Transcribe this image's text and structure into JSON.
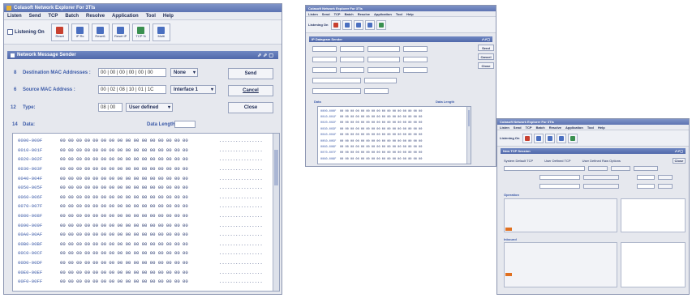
{
  "win1": {
    "title": "Colasoft Network Explorer For 3Tls",
    "menu": [
      "Listen",
      "Send",
      "TCP",
      "Batch",
      "Resolve",
      "Application",
      "Tool",
      "Help"
    ],
    "listen_toggle": "Listening On",
    "tools": [
      "Reset",
      "IP Rc",
      "Reset1",
      "Reset IP",
      "TCP %",
      "Multi"
    ],
    "panel_title": "Network Message Sender",
    "dest_label": "Destination MAC Addresses :",
    "dest_value": "00 | 00 | 00 | 00 | 00 | 00",
    "dest_select": "None",
    "src_label": "Source MAC Address :",
    "src_value": "00 | 02 | 08 | 10 | 01 | 1C",
    "src_select": "Interface 1",
    "type_label": "Type:",
    "type_value": "08 | 00",
    "type_select": "User defined",
    "data_label": "Data:",
    "data_length_label": "Data Length:",
    "send_btn": "Send",
    "cancel_btn": "Cancel",
    "close_btn": "Close",
    "num_dest": "8",
    "num_src": "6",
    "num_type": "12",
    "num_data": "14",
    "hex_rows": [
      {
        "addr": "0000-000F",
        "bytes": "00 00 00 00 00 00 00 00 00 00 00 00 00 00 00 00",
        "ascii": "................"
      },
      {
        "addr": "0010-001F",
        "bytes": "00 00 00 00 00 00 00 00 00 00 00 00 00 00 00 00",
        "ascii": "................"
      },
      {
        "addr": "0020-002F",
        "bytes": "00 00 00 00 00 00 00 00 00 00 00 00 00 00 00 00",
        "ascii": "................"
      },
      {
        "addr": "0030-003F",
        "bytes": "00 00 00 00 00 00 00 00 00 00 00 00 00 00 00 00",
        "ascii": "................"
      },
      {
        "addr": "0040-004F",
        "bytes": "00 00 00 00 00 00 00 00 00 00 00 00 00 00 00 00",
        "ascii": "................"
      },
      {
        "addr": "0050-005F",
        "bytes": "00 00 00 00 00 00 00 00 00 00 00 00 00 00 00 00",
        "ascii": "................"
      },
      {
        "addr": "0060-006F",
        "bytes": "00 00 00 00 00 00 00 00 00 00 00 00 00 00 00 00",
        "ascii": "................"
      },
      {
        "addr": "0070-007F",
        "bytes": "00 00 00 00 00 00 00 00 00 00 00 00 00 00 00 00",
        "ascii": "................"
      },
      {
        "addr": "0080-008F",
        "bytes": "00 00 00 00 00 00 00 00 00 00 00 00 00 00 00 00",
        "ascii": "................"
      },
      {
        "addr": "0090-009F",
        "bytes": "00 00 00 00 00 00 00 00 00 00 00 00 00 00 00 00",
        "ascii": "................"
      },
      {
        "addr": "00A0-00AF",
        "bytes": "00 00 00 00 00 00 00 00 00 00 00 00 00 00 00 00",
        "ascii": "................"
      },
      {
        "addr": "00B0-00BF",
        "bytes": "00 00 00 00 00 00 00 00 00 00 00 00 00 00 00 00",
        "ascii": "................"
      },
      {
        "addr": "00C0-00CF",
        "bytes": "00 00 00 00 00 00 00 00 00 00 00 00 00 00 00 00",
        "ascii": "................"
      },
      {
        "addr": "00D0-00DF",
        "bytes": "00 00 00 00 00 00 00 00 00 00 00 00 00 00 00 00",
        "ascii": "................"
      },
      {
        "addr": "00E0-00EF",
        "bytes": "00 00 00 00 00 00 00 00 00 00 00 00 00 00 00 00",
        "ascii": "................"
      },
      {
        "addr": "00F0-00FF",
        "bytes": "00 00 00 00 00 00 00 00 00 00 00 00 00 00 00 00",
        "ascii": "................"
      }
    ]
  },
  "win2": {
    "title": "Colasoft Network Explorer For 3Tls",
    "menu": [
      "Listen",
      "Send",
      "TCP",
      "Batch",
      "Resolve",
      "Application",
      "Tool",
      "Help"
    ],
    "listen_toggle": "Listening On",
    "panel_title": "IP Datagram Sender",
    "right_btns": [
      "Send",
      "Cancel",
      "Close"
    ],
    "data_label": "Data",
    "data_length_label": "Data Length",
    "hex_rows": [
      {
        "addr": "0000-000F",
        "bytes": "00 00 00 00 00 00 00 00 00 00 00 00 00 00 00 00"
      },
      {
        "addr": "0010-001F",
        "bytes": "00 00 00 00 00 00 00 00 00 00 00 00 00 00 00 00"
      },
      {
        "addr": "0020-002F",
        "bytes": "00 00 00 00 00 00 00 00 00 00 00 00 00 00 00 00"
      },
      {
        "addr": "0030-003F",
        "bytes": "00 00 00 00 00 00 00 00 00 00 00 00 00 00 00 00"
      },
      {
        "addr": "0040-004F",
        "bytes": "00 00 00 00 00 00 00 00 00 00 00 00 00 00 00 00"
      },
      {
        "addr": "0050-005F",
        "bytes": "00 00 00 00 00 00 00 00 00 00 00 00 00 00 00 00"
      },
      {
        "addr": "0060-006F",
        "bytes": "00 00 00 00 00 00 00 00 00 00 00 00 00 00 00 00"
      },
      {
        "addr": "0070-007F",
        "bytes": "00 00 00 00 00 00 00 00 00 00 00 00 00 00 00 00"
      },
      {
        "addr": "0080-008F",
        "bytes": "00 00 00 00 00 00 00 00 00 00 00 00 00 00 00 00"
      }
    ]
  },
  "win3": {
    "title": "Colasoft Network Explorer For 3Tls",
    "menu": [
      "Listen",
      "Send",
      "TCP",
      "Batch",
      "Resolve",
      "Application",
      "Tool",
      "Help"
    ],
    "listen_toggle": "Listening On",
    "panel_title": "New TCP Session",
    "opt1": "System Default TCP",
    "opt2": "User Defined TCP",
    "opt3": "User Defined Raw Options",
    "close_btn": "Close",
    "operation_label": "Operation",
    "inbound_label": "Inbound",
    "send_btn": "Send"
  }
}
